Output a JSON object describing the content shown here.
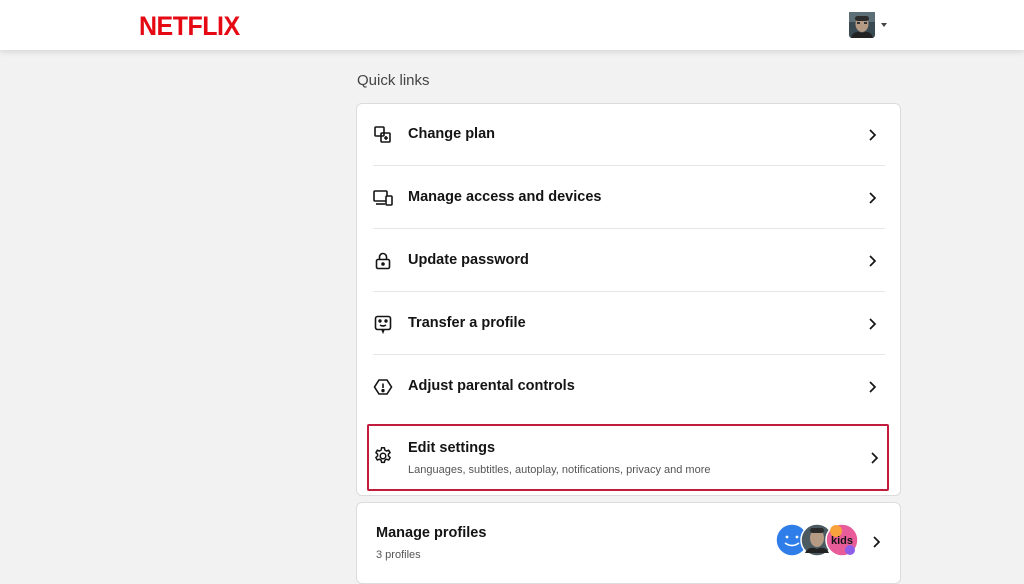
{
  "header": {
    "logo_text": "NETFLIX",
    "brand_color": "#e50914"
  },
  "quick_links": {
    "title": "Quick links",
    "items": [
      {
        "label": "Change plan",
        "icon": "plan-icon"
      },
      {
        "label": "Manage access and devices",
        "icon": "devices-icon"
      },
      {
        "label": "Update password",
        "icon": "lock-icon"
      },
      {
        "label": "Transfer a profile",
        "icon": "transfer-profile-icon"
      },
      {
        "label": "Adjust parental controls",
        "icon": "alert-shield-icon"
      },
      {
        "label": "Edit settings",
        "sublabel": "Languages, subtitles, autoplay, notifications, privacy and more",
        "icon": "gear-icon"
      }
    ],
    "highlight_color": "#c11b3e"
  },
  "profiles": {
    "title": "Manage profiles",
    "count_text": "3 profiles",
    "kids_label": "kids"
  }
}
